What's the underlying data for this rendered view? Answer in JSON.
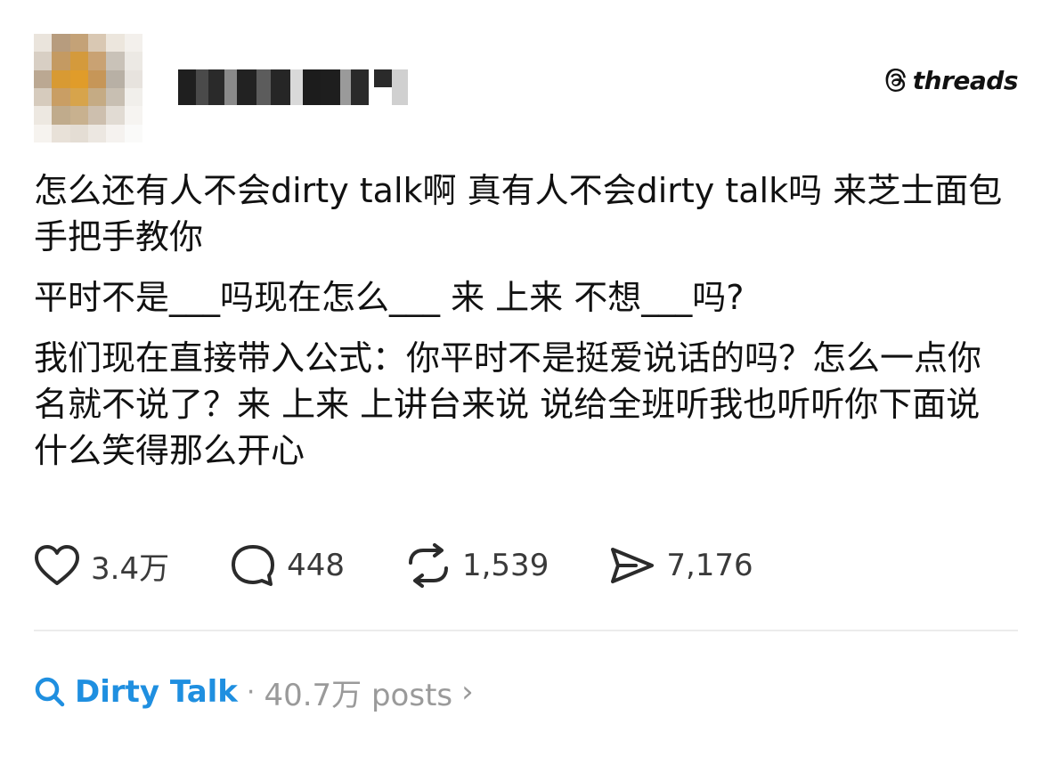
{
  "header": {
    "brand": "threads",
    "avatar_colors": [
      "#eae4dc",
      "#b79c7e",
      "#c4a277",
      "#d9c8b3",
      "#ece6dd",
      "#f3f0ec",
      "#d8cfc4",
      "#c49a62",
      "#d49a3c",
      "#c9a273",
      "#c9c2b8",
      "#ece9e4",
      "#bba892",
      "#d89a33",
      "#e09c2a",
      "#c69658",
      "#b8b0a5",
      "#e7e3de",
      "#d6cbbd",
      "#c99e64",
      "#d7a44b",
      "#c5ab84",
      "#c8bfb2",
      "#f1efeb",
      "#ede8e1",
      "#c0ab8c",
      "#c8b18f",
      "#cdbfae",
      "#e1dbd3",
      "#f6f4f1",
      "#f6f3ef",
      "#e8e1d8",
      "#e4ddd4",
      "#ece7e1",
      "#f5f2ef",
      "#fafaf9"
    ],
    "name_blur_colors": {
      "dark": "#222222",
      "mid": "#777777",
      "light": "#cfcfcf"
    }
  },
  "post": {
    "paragraphs": [
      "怎么还有人不会dirty talk啊 真有人不会dirty talk吗 来芝士面包手把手教你",
      "平时不是___吗现在怎么___ 来 上来 不想___吗?",
      "我们现在直接带入公式：你平时不是挺爱说话的吗？怎么一点你名就不说了？来 上来 上讲台来说 说给全班听我也听听你下面说什么笑得那么开心"
    ]
  },
  "actions": {
    "like": {
      "icon": "heart-icon",
      "count": "3.4万"
    },
    "comment": {
      "icon": "comment-bubble-icon",
      "count": "448"
    },
    "repost": {
      "icon": "repost-icon",
      "count": "1,539"
    },
    "share": {
      "icon": "send-icon",
      "count": "7,176"
    }
  },
  "topic": {
    "icon": "search-icon",
    "name": "Dirty Talk",
    "separator": "·",
    "count": "40.7万 posts",
    "chevron": "›",
    "accent": "#1f8fe0",
    "muted": "#9a9a9a"
  }
}
